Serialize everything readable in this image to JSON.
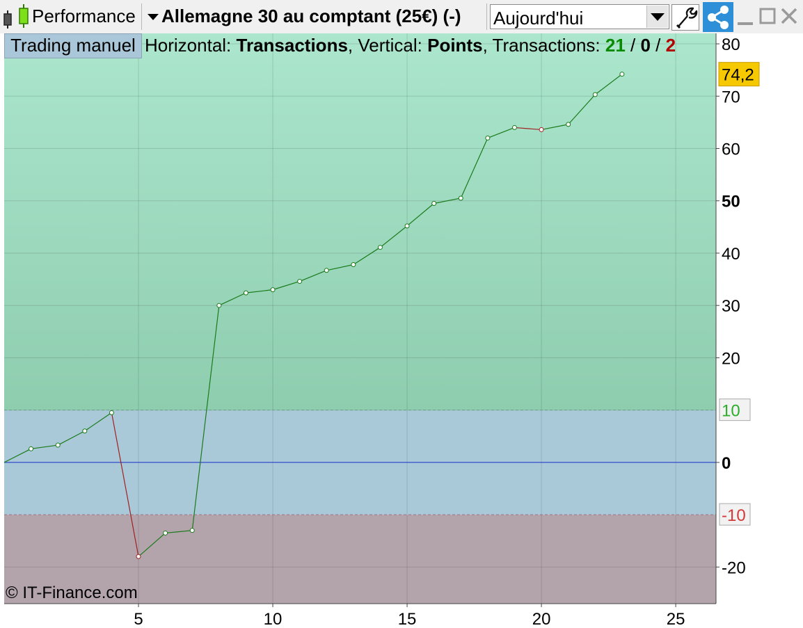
{
  "toolbar": {
    "title": "Performance",
    "instrument": "Allemagne 30 au comptant (25€) (-)",
    "period": "Aujourd'hui"
  },
  "header": {
    "manual_button": "Trading manuel",
    "horizontal_label": "Horizontal:",
    "horizontal_value": "Transactions",
    "vertical_label": "Vertical:",
    "vertical_value": "Points",
    "transactions_label": "Transactions:",
    "wins": "21",
    "neutral": "0",
    "losses": "2"
  },
  "copyright": "© IT-Finance.com",
  "colors": {
    "profit_zone": "#a6e3c9",
    "neutral_zone": "#a9c9d8",
    "loss_zone": "#b3a4ac",
    "win_line": "#1a7a1a",
    "loss_line": "#a02020",
    "zero_line": "#1a2fd0",
    "last_value_bg": "#f5c800",
    "share_bg": "#2d8fd8"
  },
  "chart_data": {
    "type": "line",
    "xlabel": "",
    "ylabel": "",
    "xlim": [
      0,
      26.5
    ],
    "ylim": [
      -27,
      82
    ],
    "x_ticks": [
      5,
      10,
      15,
      20,
      25
    ],
    "y_ticks": [
      -20,
      0,
      10,
      20,
      30,
      40,
      50,
      60,
      70,
      80
    ],
    "y_bold_ticks": [
      0,
      50
    ],
    "threshold_upper": 10,
    "threshold_lower": -10,
    "last_value_label": "74,2",
    "x": [
      0,
      1,
      2,
      3,
      4,
      5,
      6,
      7,
      8,
      9,
      10,
      11,
      12,
      13,
      14,
      15,
      16,
      17,
      18,
      19,
      20,
      21,
      22,
      23
    ],
    "y": [
      0,
      2.6,
      3.3,
      6.0,
      9.5,
      -18.0,
      -13.5,
      -13.0,
      30.0,
      32.4,
      33.0,
      34.6,
      36.7,
      37.8,
      41.1,
      45.2,
      49.5,
      50.5,
      62.0,
      64.0,
      63.6,
      64.6,
      70.3,
      74.2
    ],
    "outcomes": [
      "start",
      "win",
      "win",
      "win",
      "win",
      "loss",
      "win",
      "win",
      "win",
      "win",
      "win",
      "win",
      "win",
      "win",
      "win",
      "win",
      "win",
      "win",
      "win",
      "win",
      "loss",
      "win",
      "win",
      "win"
    ]
  }
}
